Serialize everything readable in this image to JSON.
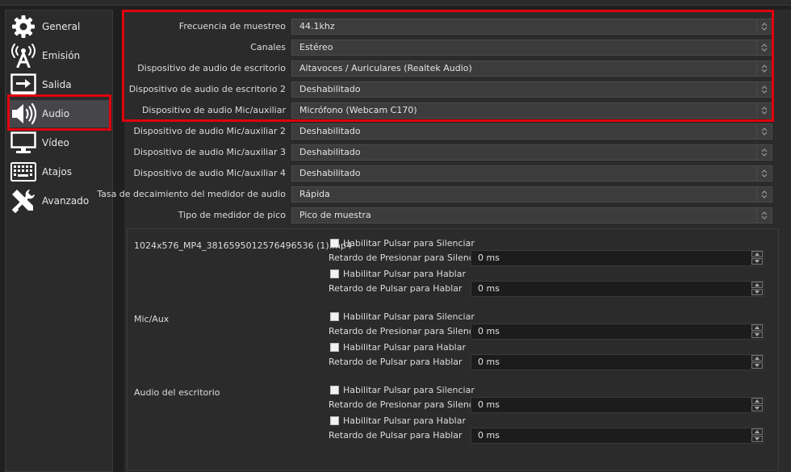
{
  "sidebar": {
    "items": [
      {
        "label": "General",
        "icon": "gear-icon"
      },
      {
        "label": "Emisión",
        "icon": "broadcast-antenna-icon"
      },
      {
        "label": "Salida",
        "icon": "output-icon"
      },
      {
        "label": "Audio",
        "icon": "speaker-icon"
      },
      {
        "label": "Vídeo",
        "icon": "monitor-icon"
      },
      {
        "label": "Atajos",
        "icon": "keyboard-icon"
      },
      {
        "label": "Avanzado",
        "icon": "tools-icon"
      }
    ],
    "selected": "Audio"
  },
  "audio_settings": [
    {
      "label": "Frecuencia de muestreo",
      "value": "44.1khz"
    },
    {
      "label": "Canales",
      "value": "Estéreo"
    },
    {
      "label": "Dispositivo de audio de escritorio",
      "value": "Altavoces / Auriculares (Realtek Audio)"
    },
    {
      "label": "Dispositivo de audio de escritorio 2",
      "value": "Deshabilitado"
    },
    {
      "label": "Dispositivo de audio Mic/auxiliar",
      "value": "Micrófono (Webcam C170)"
    },
    {
      "label": "Dispositivo de audio Mic/auxiliar 2",
      "value": "Deshabilitado"
    },
    {
      "label": "Dispositivo de audio Mic/auxiliar 3",
      "value": "Deshabilitado"
    },
    {
      "label": "Dispositivo de audio Mic/auxiliar 4",
      "value": "Deshabilitado"
    },
    {
      "label": "Tasa de decaimiento del medidor de audio",
      "value": "Rápida"
    },
    {
      "label": "Tipo de medidor de pico",
      "value": "Pico de muestra"
    }
  ],
  "hotkey_sources": [
    {
      "name": "1024x576_MP4_3816595012576496536 (1).mp4"
    },
    {
      "name": "Mic/Aux"
    },
    {
      "name": "Audio del escritorio"
    }
  ],
  "hotkey_fields": {
    "enable_mute": "Habilitar Pulsar para Silenciar",
    "mute_delay": "Retardo de Presionar para Silenciar",
    "enable_talk": "Habilitar Pulsar para Hablar",
    "talk_delay": "Retardo de Pulsar para Hablar",
    "delay_value": "0 ms"
  },
  "colors": {
    "highlight": "#e0000d",
    "panel": "#2b2b2b",
    "background": "#1f1f1f"
  }
}
